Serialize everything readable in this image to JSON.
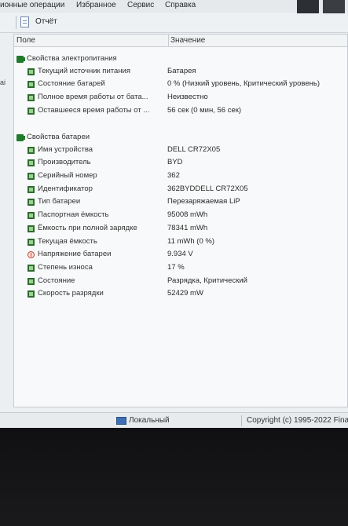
{
  "menu": [
    {
      "label": "ионные операции"
    },
    {
      "label": "Избранное"
    },
    {
      "label": "Сервис"
    },
    {
      "label": "Справка"
    }
  ],
  "toolbar": {
    "report_label": "Отчёт"
  },
  "table": {
    "col_field": "Поле",
    "col_value": "Значение"
  },
  "groups": [
    {
      "title": "Свойства электропитания",
      "items": [
        {
          "field": "Текущий источник питания",
          "value": "Батарея",
          "icon": "device-icon"
        },
        {
          "field": "Состояние батарей",
          "value": "0 % (Низкий уровень, Критический уровень)",
          "icon": "device-icon"
        },
        {
          "field": "Полное время работы от бата...",
          "value": "Неизвестно",
          "icon": "device-icon"
        },
        {
          "field": "Оставшееся время работы от ...",
          "value": "56 сек (0 мин, 56 сек)",
          "icon": "device-icon"
        }
      ]
    },
    {
      "title": "Свойства батареи",
      "items": [
        {
          "field": "Имя устройства",
          "value": "DELL CR72X05",
          "icon": "device-icon"
        },
        {
          "field": "Производитель",
          "value": "BYD",
          "icon": "device-icon"
        },
        {
          "field": "Серийный номер",
          "value": "362",
          "icon": "device-icon"
        },
        {
          "field": "Идентификатор",
          "value": "362BYDDELL CR72X05",
          "icon": "device-icon"
        },
        {
          "field": "Тип батареи",
          "value": "Перезаряжаемая LiP",
          "icon": "device-icon"
        },
        {
          "field": "Паспортная ёмкость",
          "value": "95008 mWh",
          "icon": "device-icon"
        },
        {
          "field": "Ёмкость при полной зарядке",
          "value": "78341 mWh",
          "icon": "device-icon"
        },
        {
          "field": "Текущая ёмкость",
          "value": "11 mWh (0 %)",
          "icon": "device-icon"
        },
        {
          "field": "Напряжение батареи",
          "value": "9.934 V",
          "icon": "voltage-icon"
        },
        {
          "field": "Степень износа",
          "value": "17 %",
          "icon": "device-icon"
        },
        {
          "field": "Состояние",
          "value": "Разрядка, Критический",
          "icon": "device-icon"
        },
        {
          "field": "Скорость разрядки",
          "value": "52429 mW",
          "icon": "device-icon"
        }
      ]
    }
  ],
  "side_text": "ai",
  "status": {
    "location": "Локальный",
    "copyright": "Copyright (c) 1995-2022 Fina"
  }
}
